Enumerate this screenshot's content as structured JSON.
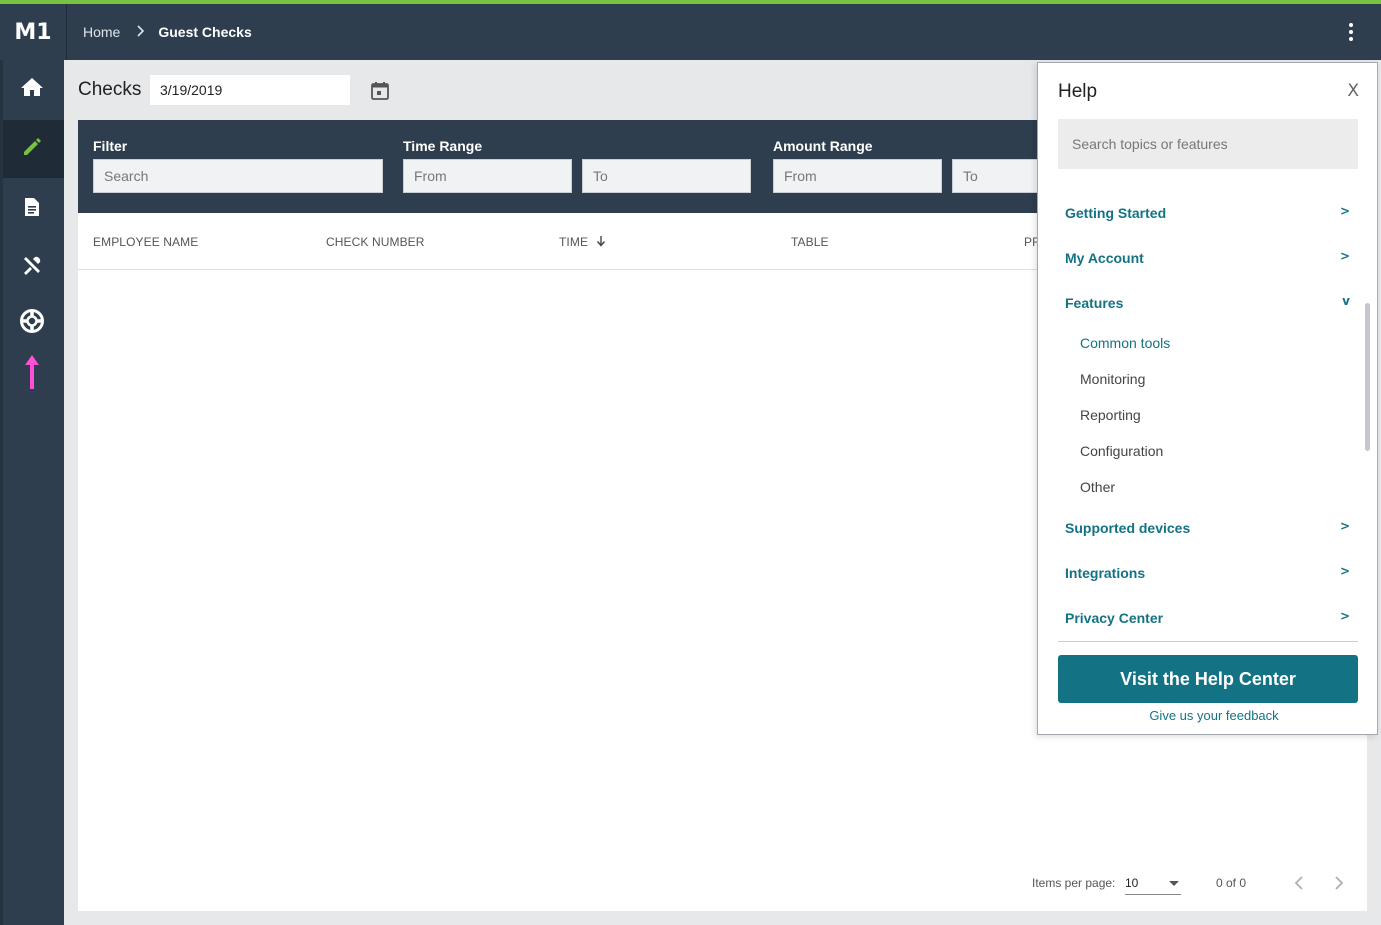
{
  "app": {
    "logo": "M1",
    "accent_color": "#7ac143",
    "nav_color": "#2e3e4e",
    "link_color": "#137385"
  },
  "breadcrumb": {
    "home": "Home",
    "separator": ">",
    "current": "Guest Checks"
  },
  "sidebar": {
    "items": [
      {
        "name": "home",
        "icon": "home-icon"
      },
      {
        "name": "edit",
        "icon": "pencil-icon",
        "active": true
      },
      {
        "name": "document",
        "icon": "document-icon"
      },
      {
        "name": "tools",
        "icon": "tools-icon"
      },
      {
        "name": "help",
        "icon": "lifebuoy-icon"
      },
      {
        "name": "scroll-up",
        "icon": "arrow-up-icon",
        "color": "#ff4fd8"
      }
    ]
  },
  "page": {
    "title": "Checks",
    "date_value": "3/19/2019"
  },
  "filters": {
    "filter_label": "Filter",
    "filter_placeholder": "Search",
    "time_range_label": "Time Range",
    "time_from_placeholder": "From",
    "time_to_placeholder": "To",
    "amount_range_label": "Amount Range",
    "amount_from_placeholder": "From",
    "amount_to_placeholder": "To"
  },
  "table": {
    "columns": [
      "EMPLOYEE NAME",
      "CHECK NUMBER",
      "TIME",
      "TABLE",
      "PR"
    ],
    "rows": []
  },
  "pagination": {
    "items_per_page_label": "Items per page:",
    "items_per_page_value": "10",
    "range_text": "0 of 0"
  },
  "help_panel": {
    "title": "Help",
    "close_label": "X",
    "search_placeholder": "Search topics or features",
    "sections": [
      {
        "label": "Getting Started",
        "chevron": ">"
      },
      {
        "label": "My Account",
        "chevron": ">"
      },
      {
        "label": "Features",
        "chevron": "v",
        "expanded": true
      },
      {
        "label": "Supported devices",
        "chevron": ">"
      },
      {
        "label": "Integrations",
        "chevron": ">"
      },
      {
        "label": "Privacy Center",
        "chevron": ">"
      }
    ],
    "feature_items": [
      "Common tools",
      "Monitoring",
      "Reporting",
      "Configuration",
      "Other"
    ],
    "cta_label": "Visit the Help Center",
    "feedback_label": "Give us your feedback"
  }
}
